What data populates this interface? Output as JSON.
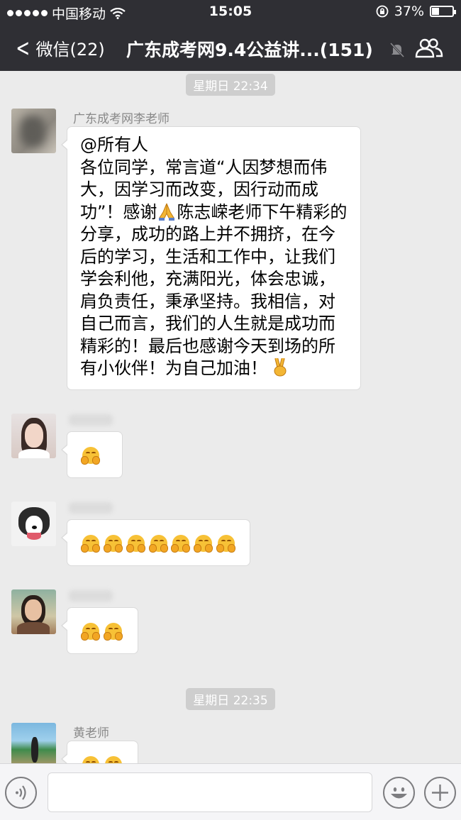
{
  "status_bar": {
    "carrier": "中国移动",
    "time": "15:05",
    "battery": "37%",
    "battery_level": 0.37
  },
  "nav": {
    "back_label": "微信(22)",
    "title": "广东成考网9.4公益讲...(151)"
  },
  "chat": {
    "timestamp_1": "星期日 22:34",
    "timestamp_2": "星期日 22:35",
    "messages": [
      {
        "sender": "广东成考网李老师",
        "text_before_emoji": "@所有人\n各位同学，常言道“人因梦想而伟大，因学习而改变，因行动而成功”！感谢",
        "text_after_emoji": "陈志嵘老师下午精彩的分享，成功的路上并不拥挤，在今后的学习，生活和工作中，让我们学会利他，充满阳光，体会忠诚，肩负责任，秉承坚持。我相信，对自己而言，我们的人生就是成功而精彩的！最后也感谢今天到场的所有小伙伴！为自己加油！",
        "inline_emojis": [
          "folded-hands-icon",
          "victory-hand-icon"
        ]
      },
      {
        "sender": "",
        "emoji": "hug-face-icon",
        "emoji_count": 1
      },
      {
        "sender": "",
        "emoji": "hug-face-icon",
        "emoji_count": 7
      },
      {
        "sender": "",
        "emoji": "hug-face-icon",
        "emoji_count": 2
      },
      {
        "sender": "黄老师",
        "emoji": "hug-face-icon",
        "emoji_count": 2
      }
    ]
  },
  "input": {
    "value": "",
    "buttons": [
      "voice-icon",
      "emoji-face-icon",
      "plus-icon"
    ]
  },
  "colors": {
    "header_bg": "#2f2f34",
    "chat_bg": "#ebebeb",
    "bubble_bg": "#ffffff",
    "timestamp_bg": "#cecece"
  }
}
